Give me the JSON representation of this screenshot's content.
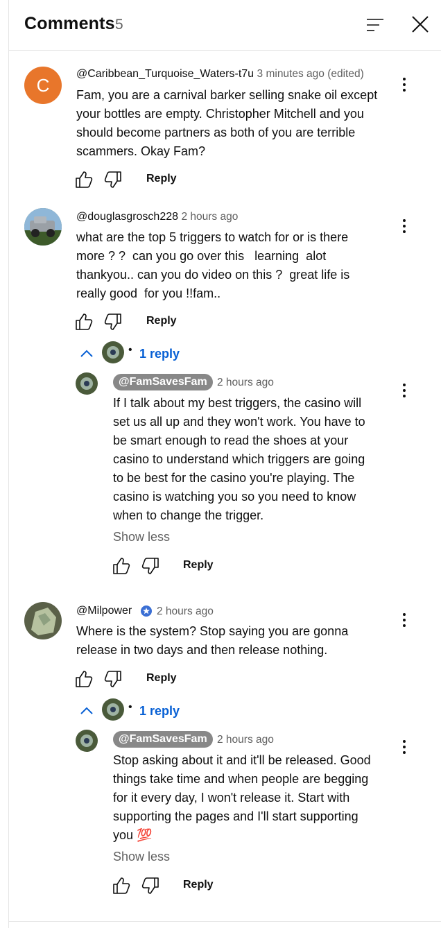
{
  "header": {
    "title": "Comments",
    "count": "5"
  },
  "reply_label": "Reply",
  "show_less_label": "Show less",
  "comments": [
    {
      "avatar_letter": "C",
      "avatar_color": "#e8762b",
      "author": "@Caribbean_Turquoise_Waters-t7u",
      "time": "3 minutes ago (edited)",
      "text": "Fam, you are a carnival barker selling snake oil except\nyour bottles are empty. Christopher Mitchell and you\nshould become partners as both of you are terrible\nscammers. Okay Fam?"
    },
    {
      "author": "@douglasgrosch228",
      "time": "2 hours ago",
      "text": "what are the top 5 triggers to watch for or is there\nmore ? ?  can you go over this   learning  alot\nthankyou.. can you do video on this ?  great life is\nreally good  for you !!fam..",
      "replies_label": "1 reply",
      "reply": {
        "author": "@FamSavesFam",
        "time": "2 hours ago",
        "text": "If I talk about my best triggers, the casino will\nset us all up and they won't work. You have to\nbe smart enough to read the shoes at your\ncasino to understand which triggers are going\nto be best for the casino you're playing. The\ncasino is watching you so you need to know\nwhen to change the trigger."
      }
    },
    {
      "author": "@Milpower",
      "time": "2 hours ago",
      "text": "Where is the system? Stop saying you are gonna\nrelease in two days and then release nothing.",
      "replies_label": "1 reply",
      "reply": {
        "author": "@FamSavesFam",
        "time": "2 hours ago",
        "text": "Stop asking about it and it'll be released. Good\nthings take time and when people are begging\nfor it every day, I won't release it. Start with\nsupporting the pages and I'll start supporting\nyou",
        "emoji": "💯"
      }
    }
  ]
}
